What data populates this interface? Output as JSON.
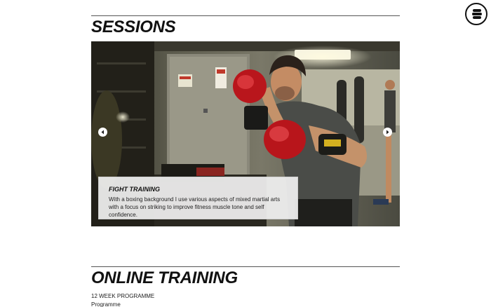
{
  "menu": {
    "icon": "hamburger-menu-icon"
  },
  "sessions": {
    "title": "SESSIONS",
    "slide": {
      "image": "boxer-training-photo",
      "caption_title": "FIGHT TRAINING",
      "caption_text": "With a boxing background I use various aspects of mixed martial arts with a focus on striking to improve fitness muscle tone and self confidence."
    },
    "prev_icon": "chevron-left-icon",
    "next_icon": "chevron-right-icon"
  },
  "online": {
    "title": "ONLINE TRAINING",
    "programme_label": "12 WEEK PROGRAMME",
    "programme_sub": "Programme"
  }
}
